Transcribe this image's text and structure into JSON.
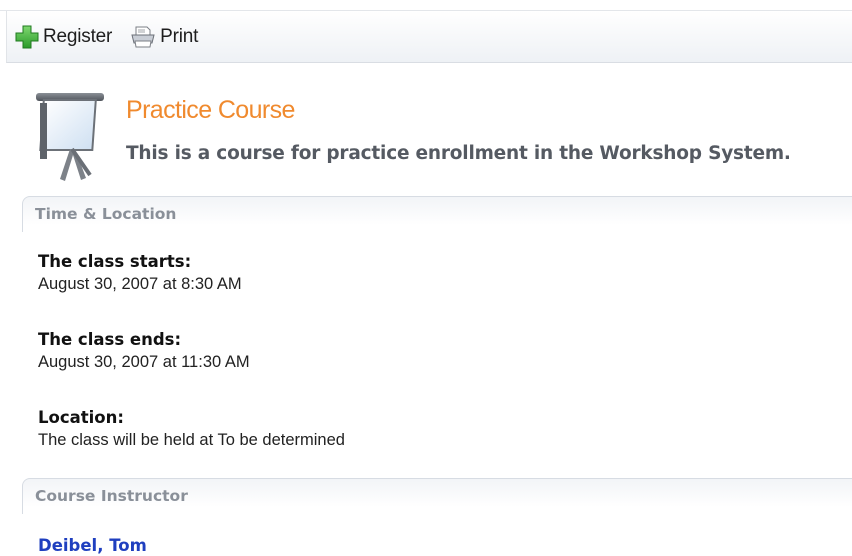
{
  "toolbar": {
    "register_label": "Register",
    "print_label": "Print"
  },
  "course": {
    "title": "Practice Course",
    "description": "This is a course for practice enrollment in the Workshop System."
  },
  "time_location": {
    "heading": "Time & Location",
    "starts_label": "The class starts:",
    "starts_value": "August 30, 2007 at 8:30 AM",
    "ends_label": "The class ends:",
    "ends_value": "August 30, 2007 at 11:30 AM",
    "location_label": "Location:",
    "location_value": "The class will be held at To be determined"
  },
  "instructor": {
    "heading": "Course Instructor",
    "name": "Deibel, Tom"
  },
  "icons": {
    "register": "plus-icon",
    "print": "printer-icon",
    "course": "presentation-board-icon"
  },
  "colors": {
    "title": "#f08a2e",
    "link": "#1f3fbf",
    "section_heading": "#8a9099",
    "plus_green": "#3aa83a"
  }
}
